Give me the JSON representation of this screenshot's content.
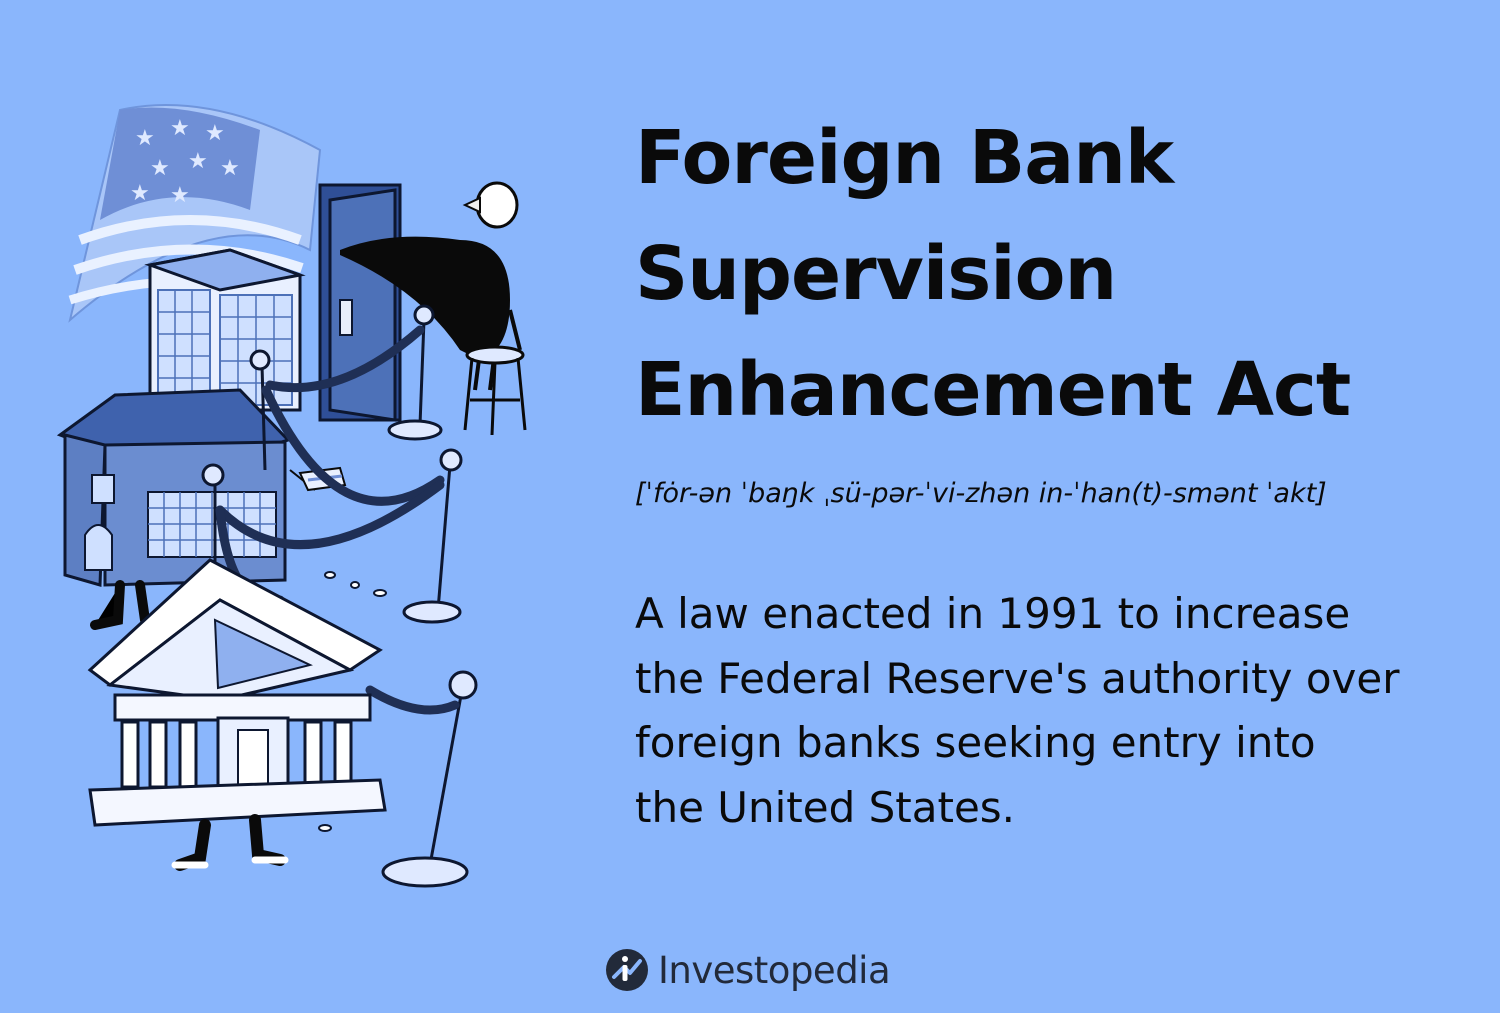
{
  "title_lines": [
    "Foreign Bank",
    "Supervision",
    "Enhancement Act"
  ],
  "pronunciation": "[ˈfȯr-ən ˈbaŋk ˌsü-pər-ˈvi-zhən in-ˈhan(t)-smənt ˈakt]",
  "definition_lines": [
    "A law enacted in 1991 to increase",
    "the Federal Reserve's authority over",
    "foreign banks seeking entry into",
    "the United States."
  ],
  "brand": {
    "name": "Investopedia",
    "icon": "investopedia-logo-icon"
  },
  "colors": {
    "background": "#8ab6fc",
    "text": "#0a0a0a",
    "navy": "#1f2f55",
    "building_blue": "#4d71b8"
  }
}
